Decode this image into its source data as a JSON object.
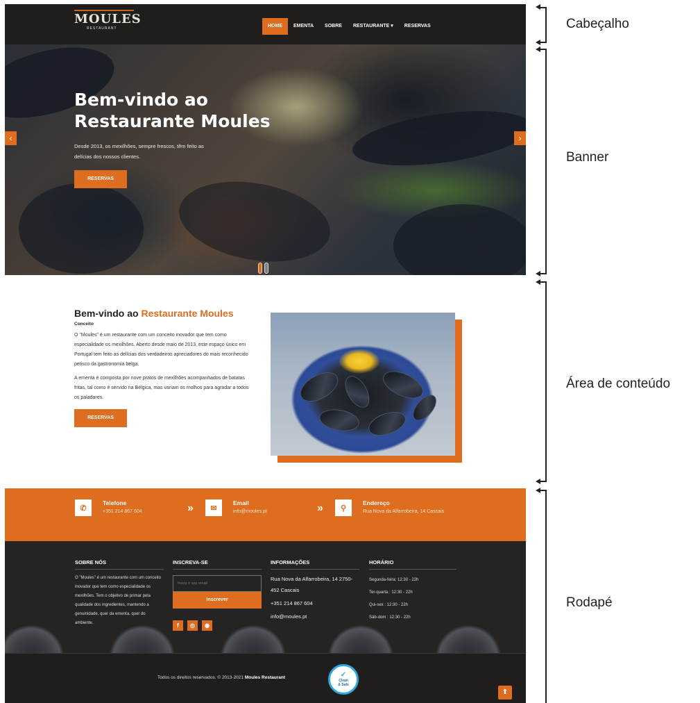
{
  "header": {
    "logo_name": "MOULES",
    "logo_sub": "RESTAURANT",
    "nav": [
      {
        "label": "HOME",
        "active": true
      },
      {
        "label": "EMENTA",
        "active": false
      },
      {
        "label": "SOBRE",
        "active": false
      },
      {
        "label": "RESTAURANTE ▾",
        "active": false
      },
      {
        "label": "RESERVAS",
        "active": false
      }
    ]
  },
  "banner": {
    "title": "Bem-vindo ao Restaurante Moules",
    "description": "Desde 2013, os mexilhões, sempre frescos, têm feito as delícias dos nossos clientes.",
    "button": "RESERVAS",
    "prev_icon": "chevron-left-icon",
    "next_icon": "chevron-right-icon"
  },
  "content": {
    "title_prefix": "Bem-vindo ao ",
    "title_accent": "Restaurante Moules",
    "subtitle": "Conceito",
    "paragraph1": "O \"Moules\" é um restaurante com um conceito inovador que tem como especialidade os mexilhões. Aberto desde maio de 2013, este espaço único em Portugal tem feito as delícias dos verdadeiros apreciadores do mais reconhecido petisco da gastronomia belga.",
    "paragraph2": "A ementa é composta por nove pratos de mexilhões acompanhados de batatas fritas, tal como é servido na Bélgica, mas variam os molhos para agradar a todos os paladares.",
    "button": "RESERVAS"
  },
  "contact": {
    "phone": {
      "label": "Telefone",
      "value": "+351 214 867 604",
      "icon": "phone-icon"
    },
    "email": {
      "label": "Email",
      "value": "info@moules.pt",
      "icon": "envelope-icon"
    },
    "address": {
      "label": "Endereço",
      "value": "Rua Nova da Alfarrobeira, 14 Cascais",
      "icon": "map-pin-icon"
    }
  },
  "footer": {
    "about": {
      "title": "SOBRE NÓS",
      "text": "O \"Moules\" é um restaurante com um conceito inovador que tem como especialidade os mexilhões. Tem o objetivo de primar pela qualidade dos ingredientes, mantendo a genuinidade, quer da ementa, quer do ambiente."
    },
    "newsletter": {
      "title": "INSCREVA-SE",
      "placeholder": "Insira o seu email",
      "button": "Inscrever"
    },
    "info": {
      "title": "INFORMAÇÕES",
      "address": "Rua Nova da Alfarrobeira, 14 2750-452 Cascais",
      "phone": "+351 214 867 604",
      "email": "info@moules.pt"
    },
    "hours": {
      "title": "HORÁRIO",
      "lines": [
        "Segunda-feira: 12:30 - 22h",
        "Ter-quarta : 12:30 - 22h",
        "Qui-sex : 12:30 - 22h",
        "Sáb-dom : 12:30 - 22h"
      ]
    },
    "social": [
      {
        "label": "f",
        "icon": "facebook-icon"
      },
      {
        "label": "◎",
        "icon": "instagram-icon"
      },
      {
        "label": "◉",
        "icon": "tripadvisor-icon"
      }
    ]
  },
  "bottom": {
    "copyright_text": "Todos os direitos reservados. © 2013-2021 ",
    "copyright_brand": "Moules Restaurant",
    "badge_line1": "Clean",
    "badge_line2": "& Safe"
  },
  "annotations": {
    "header": "Cabeçalho",
    "banner": "Banner",
    "content": "Área de conteúdo",
    "footer": "Rodapé"
  },
  "colors": {
    "accent": "#de6d1f",
    "dark": "#1f1e1c",
    "badge": "#2fa7df"
  }
}
